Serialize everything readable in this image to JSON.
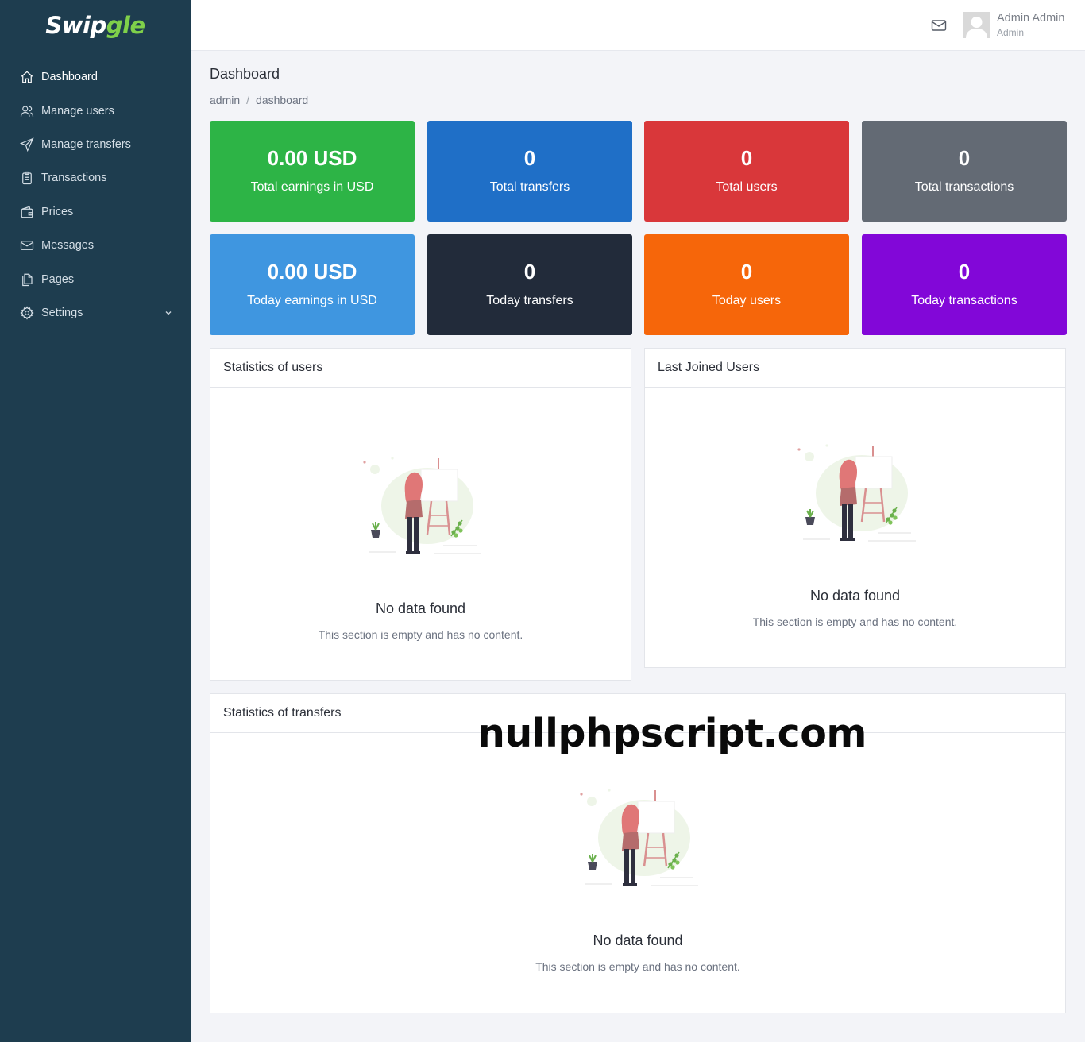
{
  "brand": {
    "part1": "Swip",
    "part2": "gle"
  },
  "sidebar": {
    "items": [
      {
        "label": "Dashboard",
        "icon": "home-icon"
      },
      {
        "label": "Manage users",
        "icon": "users-icon"
      },
      {
        "label": "Manage transfers",
        "icon": "send-icon"
      },
      {
        "label": "Transactions",
        "icon": "clipboard-icon"
      },
      {
        "label": "Prices",
        "icon": "wallet-icon"
      },
      {
        "label": "Messages",
        "icon": "mail-icon"
      },
      {
        "label": "Pages",
        "icon": "files-icon"
      },
      {
        "label": "Settings",
        "icon": "gear-icon"
      }
    ]
  },
  "header": {
    "user_name": "Admin Admin",
    "user_role": "Admin"
  },
  "page": {
    "title": "Dashboard",
    "breadcrumb": [
      "admin",
      "dashboard"
    ],
    "breadcrumb_sep": "/"
  },
  "stats": [
    {
      "value": "0.00 USD",
      "label": "Total earnings in USD",
      "color": "#2db446"
    },
    {
      "value": "0",
      "label": "Total transfers",
      "color": "#1f6fc7"
    },
    {
      "value": "0",
      "label": "Total users",
      "color": "#d9373a"
    },
    {
      "value": "0",
      "label": "Total transactions",
      "color": "#636a74"
    },
    {
      "value": "0.00 USD",
      "label": "Today earnings in USD",
      "color": "#3f96e0"
    },
    {
      "value": "0",
      "label": "Today transfers",
      "color": "#222b3a"
    },
    {
      "value": "0",
      "label": "Today users",
      "color": "#f6660a"
    },
    {
      "value": "0",
      "label": "Today transactions",
      "color": "#8207d8"
    }
  ],
  "cards": {
    "users_stats": {
      "title": "Statistics of users",
      "empty_title": "No data found",
      "empty_text": "This section is empty and has no content."
    },
    "last_joined": {
      "title": "Last Joined Users",
      "empty_title": "No data found",
      "empty_text": "This section is empty and has no content."
    },
    "transfers_stats": {
      "title": "Statistics of transfers",
      "empty_title": "No data found",
      "empty_text": "This section is empty and has no content."
    }
  },
  "watermark": "nullphpscript.com"
}
